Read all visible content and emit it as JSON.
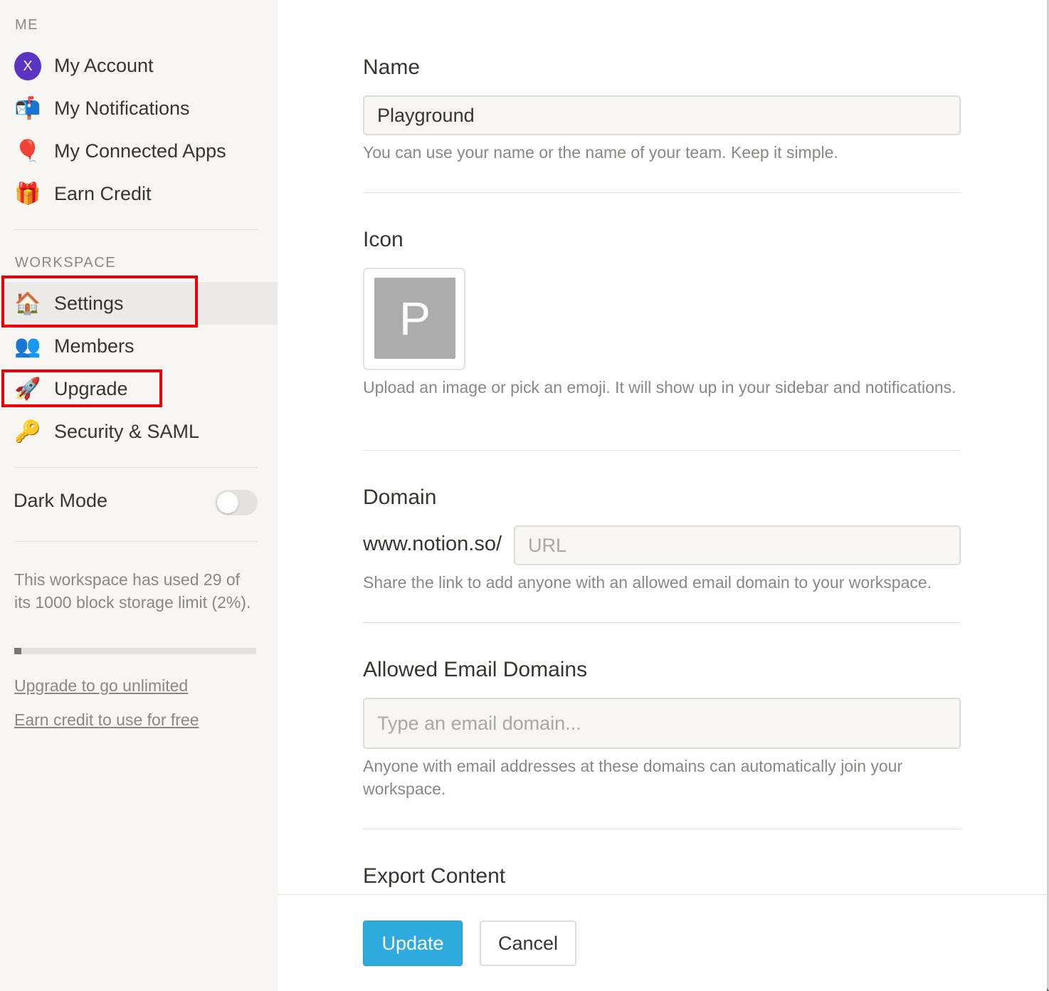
{
  "sidebar": {
    "me_label": "ME",
    "me_items": [
      {
        "label": "My Account",
        "icon": "avatar-x",
        "avatar_letter": "X"
      },
      {
        "label": "My Notifications",
        "icon": "mailbox-icon",
        "glyph": "📬"
      },
      {
        "label": "My Connected Apps",
        "icon": "balloon-icon",
        "glyph": "🎈"
      },
      {
        "label": "Earn Credit",
        "icon": "gift-icon",
        "glyph": "🎁"
      }
    ],
    "workspace_label": "WORKSPACE",
    "workspace_items": [
      {
        "label": "Settings",
        "icon": "house-icon",
        "glyph": "🏠",
        "active": true
      },
      {
        "label": "Members",
        "icon": "members-icon",
        "glyph": "👥"
      },
      {
        "label": "Upgrade",
        "icon": "rocket-icon",
        "glyph": "🚀"
      },
      {
        "label": "Security & SAML",
        "icon": "key-icon",
        "glyph": "🔑"
      }
    ],
    "dark_mode_label": "Dark Mode",
    "dark_mode_on": false,
    "storage_text": "This workspace has used 29 of its 1000 block storage limit (2%).",
    "storage_used_fraction": 0.029,
    "upgrade_link": "Upgrade to go unlimited",
    "earn_link": "Earn credit to use for free"
  },
  "main": {
    "name": {
      "heading": "Name",
      "value": "Playground",
      "help": "You can use your name or the name of your team. Keep it simple."
    },
    "icon": {
      "heading": "Icon",
      "letter": "P",
      "help": "Upload an image or pick an emoji. It will show up in your sidebar and notifications."
    },
    "domain": {
      "heading": "Domain",
      "prefix": "www.notion.so/",
      "placeholder": "URL",
      "help": "Share the link to add anyone with an allowed email domain to your workspace."
    },
    "allowed": {
      "heading": "Allowed Email Domains",
      "placeholder": "Type an email domain...",
      "help": "Anyone with email addresses at these domains can automatically join your workspace."
    },
    "export": {
      "heading": "Export Content"
    },
    "buttons": {
      "update": "Update",
      "cancel": "Cancel"
    }
  },
  "colors": {
    "sidebar_bg": "#f7f6f3",
    "accent": "#2eaadc",
    "highlight": "#e8000b",
    "avatar": "#5b34c4"
  }
}
